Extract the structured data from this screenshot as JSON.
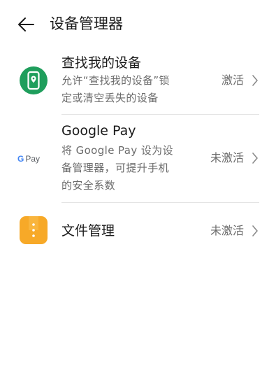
{
  "header": {
    "title": "设备管理器",
    "back_icon": "arrow-left-icon"
  },
  "rows": [
    {
      "title": "查找我的设备",
      "desc_lines": [
        "允许“查找我的设备”锁",
        "定或清空丢失的设备"
      ],
      "status": "激活",
      "icon": "find-device-icon",
      "icon_color": "#1f9e5c"
    },
    {
      "title": "Google Pay",
      "desc_lines": [
        "将 Google Pay 设为设",
        "备管理器，可提升手机",
        "的安全系数"
      ],
      "status": "未激活",
      "icon": "google-pay-icon",
      "icon_text": {
        "g": "G",
        "pay": "Pay"
      }
    },
    {
      "title": "文件管理",
      "desc_lines": [],
      "status": "未激活",
      "icon": "file-manager-icon",
      "icon_color": "#f7a928"
    }
  ]
}
